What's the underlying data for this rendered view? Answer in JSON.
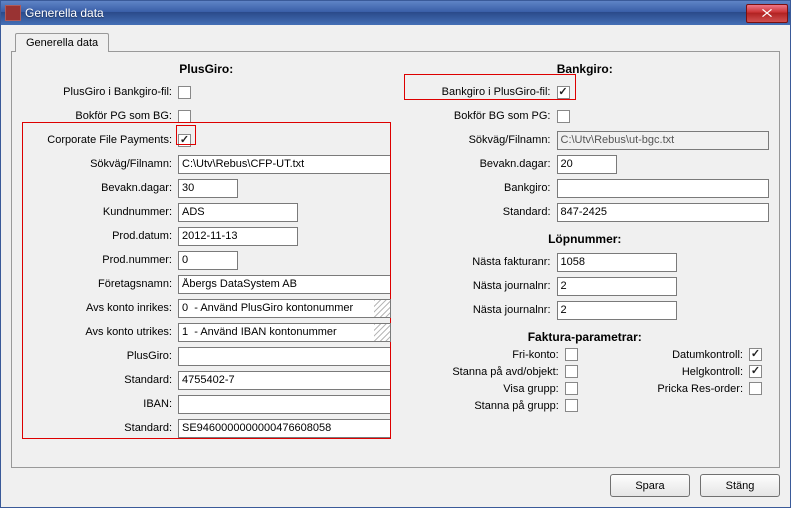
{
  "window": {
    "title": "Generella data"
  },
  "tabs": {
    "active": "Generella data"
  },
  "plusgiro": {
    "title": "PlusGiro:",
    "rows": {
      "pg_in_bg": {
        "label": "PlusGiro i Bankgiro-fil:",
        "checked": false
      },
      "bokfor_pg_som_bg": {
        "label": "Bokför PG som BG:",
        "checked": false
      },
      "cfp": {
        "label": "Corporate File Payments:",
        "checked": true
      },
      "sokvag": {
        "label": "Sökväg/Filnamn:",
        "value": "C:\\Utv\\Rebus\\CFP-UT.txt"
      },
      "bevdagar": {
        "label": "Bevakn.dagar:",
        "value": "30"
      },
      "kundnummer": {
        "label": "Kundnummer:",
        "value": "ADS"
      },
      "proddatum": {
        "label": "Prod.datum:",
        "value": "2012-11-13"
      },
      "prodnummer": {
        "label": "Prod.nummer:",
        "value": "0"
      },
      "foretag": {
        "label": "Företagsnamn:",
        "value": "Åbergs DataSystem AB"
      },
      "avs_in": {
        "label": "Avs konto inrikes:",
        "value": "0  - Använd PlusGiro kontonummer"
      },
      "avs_ut": {
        "label": "Avs konto utrikes:",
        "value": "1  - Använd IBAN kontonummer"
      },
      "plusgiro": {
        "label": "PlusGiro:",
        "value": ""
      },
      "standard": {
        "label": "Standard:",
        "value": "4755402-7"
      },
      "iban": {
        "label": "IBAN:",
        "value": ""
      },
      "standard2": {
        "label": "Standard:",
        "value": "SE9460000000000476608058"
      }
    }
  },
  "bankgiro": {
    "title": "Bankgiro:",
    "rows": {
      "bg_in_pg": {
        "label": "Bankgiro i PlusGiro-fil:",
        "checked": true
      },
      "bokfor_bg_som_pg": {
        "label": "Bokför BG som PG:",
        "checked": false
      },
      "sokvag": {
        "label": "Sökväg/Filnamn:",
        "value": "C:\\Utv\\Rebus\\ut-bgc.txt",
        "readonly": true
      },
      "bevdagar": {
        "label": "Bevakn.dagar:",
        "value": "20"
      },
      "bankgiro": {
        "label": "Bankgiro:",
        "value": ""
      },
      "standard": {
        "label": "Standard:",
        "value": "847-2425"
      }
    }
  },
  "lopnummer": {
    "title": "Löpnummer:",
    "rows": {
      "faktura": {
        "label": "Nästa fakturanr:",
        "value": "1058"
      },
      "journal1": {
        "label": "Nästa journalnr:",
        "value": "2"
      },
      "journal2": {
        "label": "Nästa journalnr:",
        "value": "2"
      }
    }
  },
  "faktparam": {
    "title": "Faktura-parametrar:",
    "rows": {
      "frikonto": {
        "label": "Fri-konto:",
        "checked": false
      },
      "datumkontroll": {
        "label": "Datumkontroll:",
        "checked": true
      },
      "stanna_avd": {
        "label": "Stanna på avd/objekt:",
        "checked": false
      },
      "helgkontroll": {
        "label": "Helgkontroll:",
        "checked": true
      },
      "visa_grupp": {
        "label": "Visa grupp:",
        "checked": false
      },
      "pricka_res": {
        "label": "Pricka Res-order:",
        "checked": false
      },
      "stanna_grupp": {
        "label": "Stanna på grupp:",
        "checked": false
      }
    }
  },
  "buttons": {
    "save": "Spara",
    "close": "Stäng"
  }
}
